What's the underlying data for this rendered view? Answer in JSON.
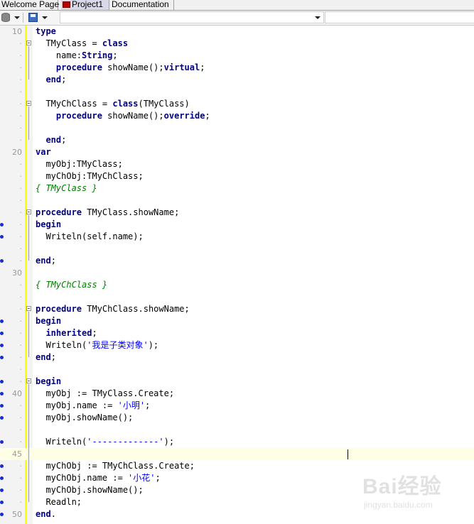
{
  "tabs": [
    {
      "label": "Welcome Page",
      "active": false
    },
    {
      "label": "Project1",
      "active": true
    },
    {
      "label": "Documentation",
      "active": false
    }
  ],
  "toolbar": {
    "db_icon": "database-icon",
    "save_icon": "save-icon",
    "unit_combo_value": "",
    "method_combo_value": ""
  },
  "editor": {
    "current_line": 45,
    "lines": [
      {
        "n": 10,
        "show_num": true,
        "dot": false,
        "fold": false,
        "segs": [
          [
            "kw",
            "type"
          ]
        ]
      },
      {
        "n": 11,
        "show_num": false,
        "dot": false,
        "fold": true,
        "segs": [
          [
            "t",
            "  TMyClass = "
          ],
          [
            "kw",
            "class"
          ]
        ]
      },
      {
        "n": 12,
        "show_num": false,
        "dot": false,
        "fold": false,
        "segs": [
          [
            "t",
            "    name:"
          ],
          [
            "kw",
            "String"
          ],
          [
            "t",
            ";"
          ]
        ]
      },
      {
        "n": 13,
        "show_num": false,
        "dot": false,
        "fold": false,
        "segs": [
          [
            "t",
            "    "
          ],
          [
            "kw",
            "procedure"
          ],
          [
            "t",
            " showName();"
          ],
          [
            "kw",
            "virtual"
          ],
          [
            "t",
            ";"
          ]
        ]
      },
      {
        "n": 14,
        "show_num": false,
        "dot": false,
        "fold": false,
        "segs": [
          [
            "t",
            "  "
          ],
          [
            "kw",
            "end"
          ],
          [
            "t",
            ";"
          ]
        ]
      },
      {
        "n": 15,
        "show_num": false,
        "dot": false,
        "fold": false,
        "segs": []
      },
      {
        "n": 16,
        "show_num": false,
        "dot": false,
        "fold": true,
        "segs": [
          [
            "t",
            "  TMyChClass = "
          ],
          [
            "kw",
            "class"
          ],
          [
            "t",
            "(TMyClass)"
          ]
        ]
      },
      {
        "n": 17,
        "show_num": false,
        "dot": false,
        "fold": false,
        "segs": [
          [
            "t",
            "    "
          ],
          [
            "kw",
            "procedure"
          ],
          [
            "t",
            " showName();"
          ],
          [
            "kw",
            "override"
          ],
          [
            "t",
            ";"
          ]
        ]
      },
      {
        "n": 18,
        "show_num": false,
        "dot": false,
        "fold": false,
        "segs": []
      },
      {
        "n": 19,
        "show_num": false,
        "dot": false,
        "fold": false,
        "segs": [
          [
            "t",
            "  "
          ],
          [
            "kw",
            "end"
          ],
          [
            "t",
            ";"
          ]
        ]
      },
      {
        "n": 20,
        "show_num": true,
        "dot": false,
        "fold": false,
        "segs": [
          [
            "kw",
            "var"
          ]
        ]
      },
      {
        "n": 21,
        "show_num": false,
        "dot": false,
        "fold": false,
        "segs": [
          [
            "t",
            "  myObj:TMyClass;"
          ]
        ]
      },
      {
        "n": 22,
        "show_num": false,
        "dot": false,
        "fold": false,
        "segs": [
          [
            "t",
            "  myChObj:TMyChClass;"
          ]
        ]
      },
      {
        "n": 23,
        "show_num": false,
        "dot": false,
        "fold": false,
        "segs": [
          [
            "cm",
            "{ TMyClass }"
          ]
        ]
      },
      {
        "n": 24,
        "show_num": false,
        "dot": false,
        "fold": false,
        "segs": []
      },
      {
        "n": 25,
        "show_num": false,
        "dot": false,
        "fold": true,
        "segs": [
          [
            "kw",
            "procedure"
          ],
          [
            "t",
            " TMyClass.showName;"
          ]
        ]
      },
      {
        "n": 26,
        "show_num": false,
        "dot": true,
        "fold": false,
        "segs": [
          [
            "kw",
            "begin"
          ]
        ]
      },
      {
        "n": 27,
        "show_num": false,
        "dot": true,
        "fold": false,
        "segs": [
          [
            "t",
            "  Writeln(self.name);"
          ]
        ]
      },
      {
        "n": 28,
        "show_num": false,
        "dot": false,
        "fold": false,
        "segs": []
      },
      {
        "n": 29,
        "show_num": false,
        "dot": true,
        "fold": false,
        "segs": [
          [
            "kw",
            "end"
          ],
          [
            "t",
            ";"
          ]
        ]
      },
      {
        "n": 30,
        "show_num": true,
        "dot": false,
        "fold": false,
        "segs": []
      },
      {
        "n": 31,
        "show_num": false,
        "dot": false,
        "fold": false,
        "segs": [
          [
            "cm",
            "{ TMyChClass }"
          ]
        ]
      },
      {
        "n": 32,
        "show_num": false,
        "dot": false,
        "fold": false,
        "segs": []
      },
      {
        "n": 33,
        "show_num": false,
        "dot": false,
        "fold": true,
        "segs": [
          [
            "kw",
            "procedure"
          ],
          [
            "t",
            " TMyChClass.showName;"
          ]
        ]
      },
      {
        "n": 34,
        "show_num": false,
        "dot": true,
        "fold": false,
        "segs": [
          [
            "kw",
            "begin"
          ]
        ]
      },
      {
        "n": 35,
        "show_num": false,
        "dot": true,
        "fold": false,
        "segs": [
          [
            "t",
            "  "
          ],
          [
            "kw",
            "inherited"
          ],
          [
            "t",
            ";"
          ]
        ]
      },
      {
        "n": 36,
        "show_num": false,
        "dot": true,
        "fold": false,
        "segs": [
          [
            "t",
            "  Writeln("
          ],
          [
            "st",
            "'我是子类对象'"
          ],
          [
            "t",
            ");"
          ]
        ]
      },
      {
        "n": 37,
        "show_num": false,
        "dot": true,
        "fold": false,
        "segs": [
          [
            "kw",
            "end"
          ],
          [
            "t",
            ";"
          ]
        ]
      },
      {
        "n": 38,
        "show_num": false,
        "dot": false,
        "fold": false,
        "segs": []
      },
      {
        "n": 39,
        "show_num": false,
        "dot": true,
        "fold": true,
        "segs": [
          [
            "kw",
            "begin"
          ]
        ]
      },
      {
        "n": 40,
        "show_num": true,
        "dot": true,
        "fold": false,
        "segs": [
          [
            "t",
            "  myObj := TMyClass.Create;"
          ]
        ]
      },
      {
        "n": 41,
        "show_num": false,
        "dot": true,
        "fold": false,
        "segs": [
          [
            "t",
            "  myObj.name := "
          ],
          [
            "st",
            "'小明'"
          ],
          [
            "t",
            ";"
          ]
        ]
      },
      {
        "n": 42,
        "show_num": false,
        "dot": true,
        "fold": false,
        "segs": [
          [
            "t",
            "  myObj.showName();"
          ]
        ]
      },
      {
        "n": 43,
        "show_num": false,
        "dot": false,
        "fold": false,
        "segs": []
      },
      {
        "n": 44,
        "show_num": false,
        "dot": true,
        "fold": false,
        "segs": [
          [
            "t",
            "  Writeln("
          ],
          [
            "st",
            "'-------------'"
          ],
          [
            "t",
            ");"
          ]
        ]
      },
      {
        "n": 45,
        "show_num": true,
        "dot": false,
        "fold": false,
        "segs": []
      },
      {
        "n": 46,
        "show_num": false,
        "dot": true,
        "fold": false,
        "segs": [
          [
            "t",
            "  myChObj := TMyChClass.Create;"
          ]
        ]
      },
      {
        "n": 47,
        "show_num": false,
        "dot": true,
        "fold": false,
        "segs": [
          [
            "t",
            "  myChObj.name := "
          ],
          [
            "st",
            "'小花'"
          ],
          [
            "t",
            ";"
          ]
        ]
      },
      {
        "n": 48,
        "show_num": false,
        "dot": true,
        "fold": false,
        "segs": [
          [
            "t",
            "  myChObj.showName();"
          ]
        ]
      },
      {
        "n": 49,
        "show_num": false,
        "dot": true,
        "fold": false,
        "segs": [
          [
            "t",
            "  Readln;"
          ]
        ]
      },
      {
        "n": 50,
        "show_num": true,
        "dot": true,
        "fold": false,
        "segs": [
          [
            "kw",
            "end"
          ],
          [
            "t",
            "."
          ]
        ]
      }
    ]
  },
  "watermark": {
    "main": "Bai经验",
    "sub": "jingyan.baidu.com"
  }
}
